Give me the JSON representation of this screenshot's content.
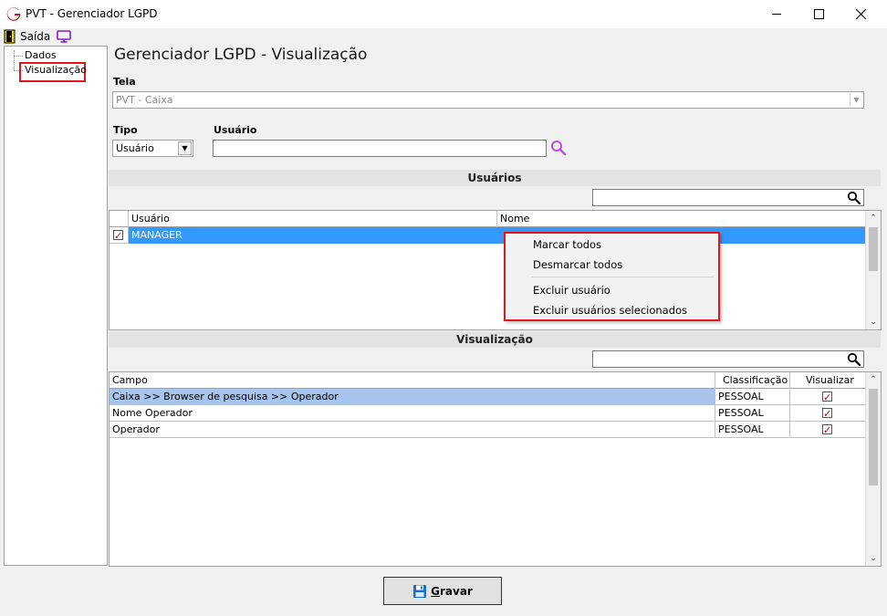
{
  "window": {
    "title": "PVT - Gerenciador LGPD",
    "min_glyph": "—",
    "max_glyph": "☐",
    "close_glyph": "✕"
  },
  "toolbar": {
    "exit_label": "Saída"
  },
  "tree": {
    "items": [
      {
        "label": "Dados"
      },
      {
        "label": "Visualização",
        "highlighted": true
      }
    ]
  },
  "page": {
    "title": "Gerenciador LGPD - Visualização"
  },
  "form": {
    "tela_label": "Tela",
    "tela_value": "PVT - Caixa",
    "tipo_label": "Tipo",
    "tipo_value": "Usuário",
    "usuario_label": "Usuário",
    "usuario_value": ""
  },
  "usuarios_section": {
    "header": "Usuários",
    "search_value": "",
    "columns": [
      "Usuário",
      "Nome"
    ],
    "rows": [
      {
        "checked": true,
        "usuario": "MANAGER",
        "nome": "",
        "selected": true
      }
    ]
  },
  "context_menu": {
    "items": [
      "Marcar todos",
      "Desmarcar todos",
      "Excluir usuário",
      "Excluir usuários selecionados"
    ]
  },
  "visualizacao_section": {
    "header": "Visualização",
    "search_value": "",
    "columns": [
      "Campo",
      "Classificação",
      "Visualizar"
    ],
    "rows": [
      {
        "campo": "Caixa >> Browser de pesquisa >> Operador",
        "classificacao": "PESSOAL",
        "visualizar": true,
        "selected": true
      },
      {
        "campo": "Nome Operador",
        "classificacao": "PESSOAL",
        "visualizar": true,
        "selected": false
      },
      {
        "campo": "Operador",
        "classificacao": "PESSOAL",
        "visualizar": true,
        "selected": false
      }
    ]
  },
  "buttons": {
    "save_first_letter": "G",
    "save_rest": "ravar"
  },
  "colors": {
    "selection_blue": "#3399ff",
    "selection_light_blue": "#a7c4ec",
    "highlight_red": "#e3171a",
    "logo_red": "#c0191f"
  },
  "icons": {
    "app": "app-logo-g",
    "exit": "exit-door-icon",
    "monitor": "monitor-icon",
    "search": "search-icon",
    "save": "floppy-disk-icon"
  }
}
